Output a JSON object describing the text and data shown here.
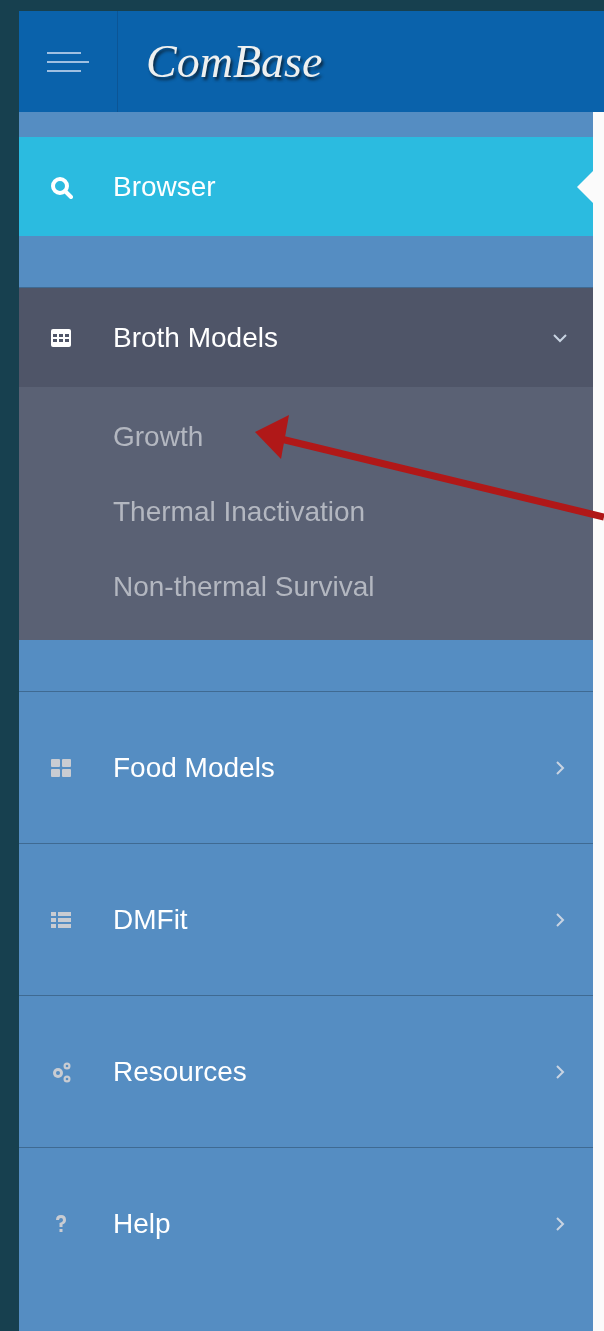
{
  "header": {
    "logo": "ComBase"
  },
  "menu": [
    {
      "kind": "link",
      "label": "Browser",
      "selected": true
    },
    {
      "kind": "submenu",
      "label": "Broth Models",
      "selected": false,
      "expanded": true,
      "children": [
        {
          "label": "Growth"
        },
        {
          "label": "Thermal Inactivation"
        },
        {
          "label": "Non-thermal Survival"
        }
      ]
    },
    {
      "kind": "submenu",
      "label": "Food Models",
      "selected": false,
      "expanded": false
    },
    {
      "kind": "submenu",
      "label": "DMFit",
      "selected": false,
      "expanded": false
    },
    {
      "kind": "submenu",
      "label": "Resources",
      "selected": false,
      "expanded": false
    },
    {
      "kind": "submenu",
      "label": "Help",
      "selected": false,
      "expanded": false
    }
  ]
}
